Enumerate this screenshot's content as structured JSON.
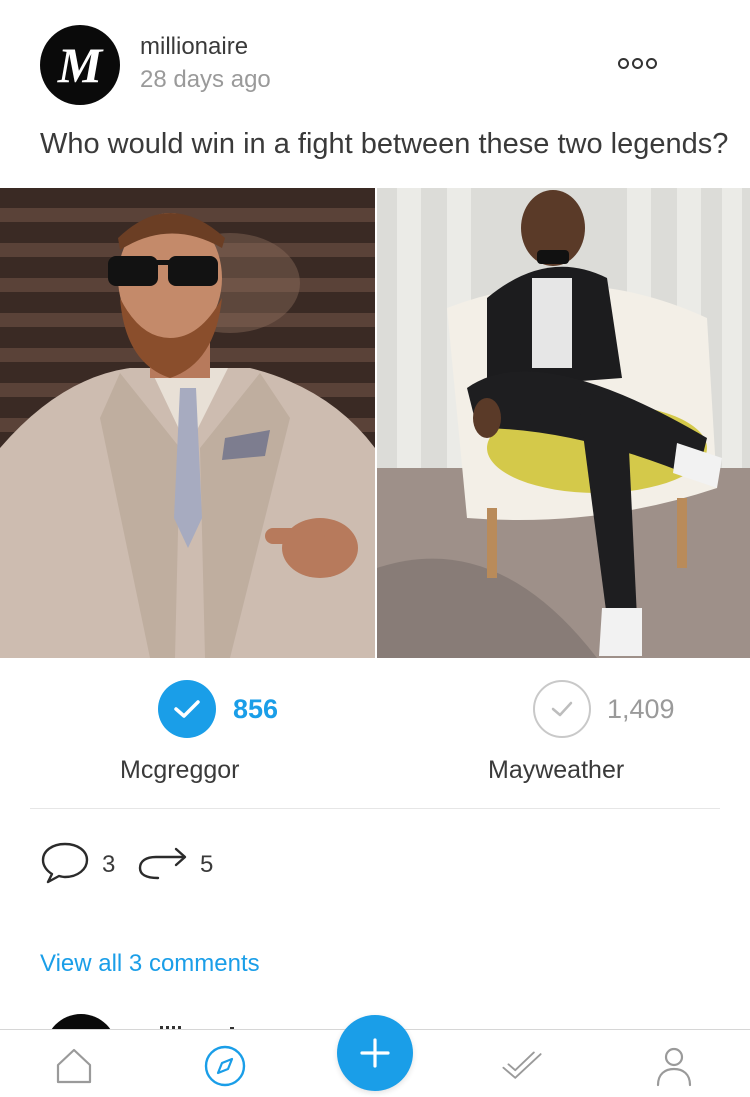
{
  "post": {
    "author": "millionaire",
    "avatar_letter": "M",
    "time_ago": "28 days ago",
    "question": "Who would win in a fight between these two legends?"
  },
  "icons": {
    "more": "more-options-icon",
    "comment": "comment-bubble-icon",
    "repost": "repost-arrow-icon",
    "home": "home-icon",
    "explore": "compass-icon",
    "create": "plus-icon",
    "votes": "check-icon",
    "profile": "person-icon"
  },
  "poll": {
    "options": [
      {
        "label": "Mcgreggor",
        "votes": "856",
        "selected": true
      },
      {
        "label": "Mayweather",
        "votes": "1,409",
        "selected": false
      }
    ]
  },
  "engagement": {
    "comments": "3",
    "reposts": "5",
    "view_all": "View all 3 comments"
  },
  "colors": {
    "accent": "#1a9ee8",
    "text": "#3a3a3a",
    "muted": "#9a9a9a"
  }
}
